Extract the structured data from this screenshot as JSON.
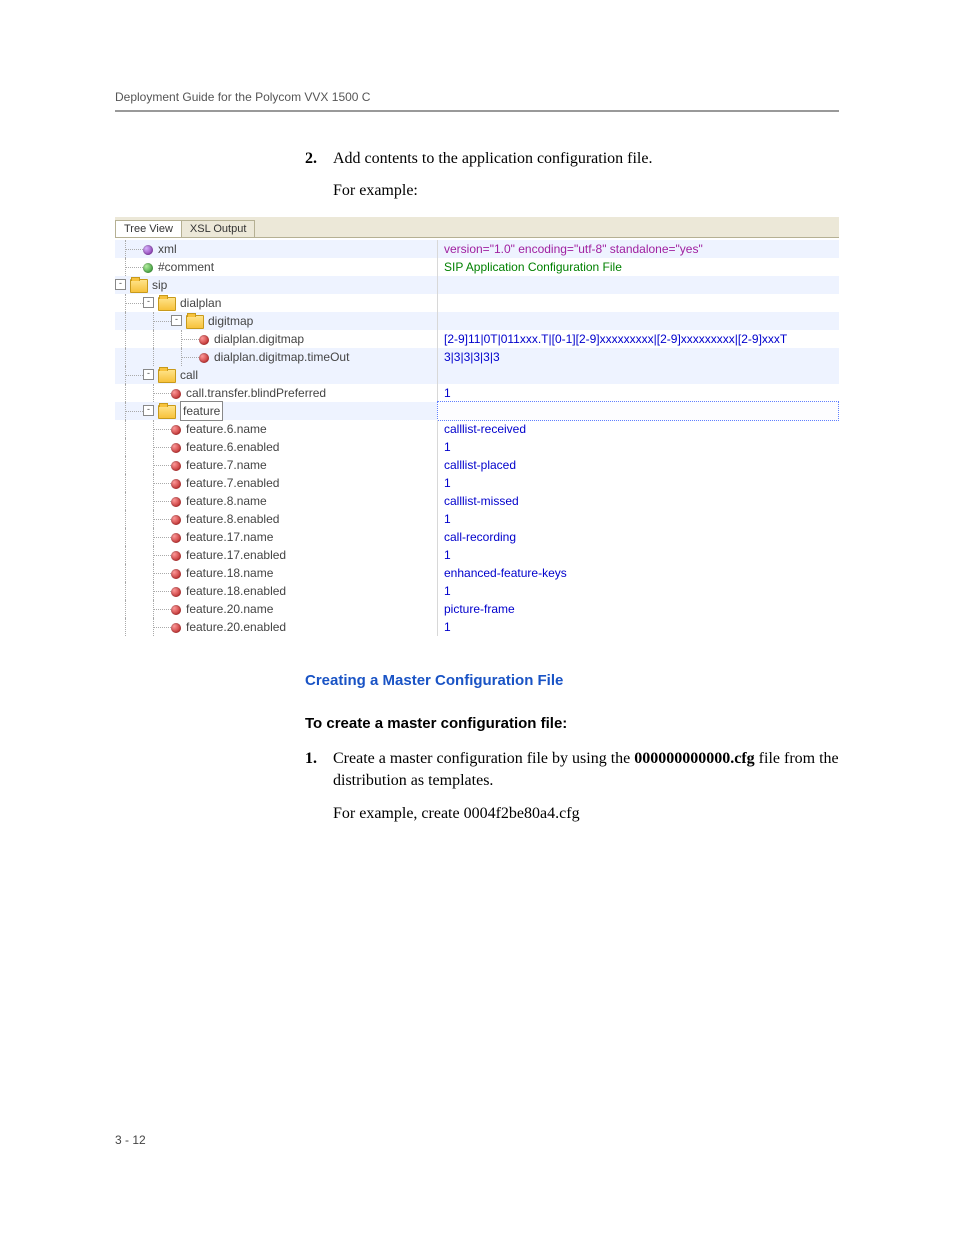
{
  "header": "Deployment Guide for the Polycom VVX 1500 C",
  "step2": {
    "num": "2.",
    "text": "Add contents to the application configuration file.",
    "sub": "For example:"
  },
  "tabs": {
    "active": "Tree View",
    "inactive": "XSL Output"
  },
  "tree": [
    {
      "indent": 1,
      "icon": "ball-purple",
      "label": "xml",
      "value": "version=\"1.0\" encoding=\"utf-8\" standalone=\"yes\"",
      "vclass": "purple",
      "hl": true
    },
    {
      "indent": 1,
      "icon": "ball-green",
      "label": "#comment",
      "value": "SIP Application Configuration File",
      "vclass": "green"
    },
    {
      "indent": 0,
      "expander": "-",
      "icon": "folder",
      "label": "sip",
      "value": "",
      "hl": true
    },
    {
      "indent": 1,
      "expander": "-",
      "icon": "folder",
      "label": "dialplan",
      "value": ""
    },
    {
      "indent": 2,
      "expander": "-",
      "icon": "folder",
      "label": "digitmap",
      "value": "",
      "hl": true
    },
    {
      "indent": 3,
      "icon": "ball-red",
      "label": "dialplan.digitmap",
      "value": "[2-9]11|0T|011xxx.T|[0-1][2-9]xxxxxxxxx|[2-9]xxxxxxxxx|[2-9]xxxT",
      "vclass": "blue"
    },
    {
      "indent": 3,
      "icon": "ball-red",
      "label": "dialplan.digitmap.timeOut",
      "value": "3|3|3|3|3|3",
      "vclass": "blue",
      "hl": true
    },
    {
      "indent": 1,
      "expander": "-",
      "icon": "folder",
      "label": "call",
      "value": "",
      "hl": true
    },
    {
      "indent": 2,
      "icon": "ball-red",
      "label": "call.transfer.blindPreferred",
      "value": "1",
      "vclass": "blue"
    },
    {
      "indent": 1,
      "expander": "-",
      "icon": "folder",
      "label": "feature",
      "value": "",
      "hl": true,
      "boxed": true,
      "selectedValue": true
    },
    {
      "indent": 2,
      "icon": "ball-red",
      "label": "feature.6.name",
      "value": "calllist-received",
      "vclass": "blue"
    },
    {
      "indent": 2,
      "icon": "ball-red",
      "label": "feature.6.enabled",
      "value": "1",
      "vclass": "blue"
    },
    {
      "indent": 2,
      "icon": "ball-red",
      "label": "feature.7.name",
      "value": "calllist-placed",
      "vclass": "blue"
    },
    {
      "indent": 2,
      "icon": "ball-red",
      "label": "feature.7.enabled",
      "value": "1",
      "vclass": "blue"
    },
    {
      "indent": 2,
      "icon": "ball-red",
      "label": "feature.8.name",
      "value": "calllist-missed",
      "vclass": "blue"
    },
    {
      "indent": 2,
      "icon": "ball-red",
      "label": "feature.8.enabled",
      "value": "1",
      "vclass": "blue"
    },
    {
      "indent": 2,
      "icon": "ball-red",
      "label": "feature.17.name",
      "value": "call-recording",
      "vclass": "blue"
    },
    {
      "indent": 2,
      "icon": "ball-red",
      "label": "feature.17.enabled",
      "value": "1",
      "vclass": "blue"
    },
    {
      "indent": 2,
      "icon": "ball-red",
      "label": "feature.18.name",
      "value": "enhanced-feature-keys",
      "vclass": "blue"
    },
    {
      "indent": 2,
      "icon": "ball-red",
      "label": "feature.18.enabled",
      "value": "1",
      "vclass": "blue"
    },
    {
      "indent": 2,
      "icon": "ball-red",
      "label": "feature.20.name",
      "value": "picture-frame",
      "vclass": "blue"
    },
    {
      "indent": 2,
      "icon": "ball-red",
      "label": "feature.20.enabled",
      "value": "1",
      "vclass": "blue"
    }
  ],
  "section": {
    "blue_heading": "Creating a Master Configuration File",
    "black_heading": "To create a master configuration file:",
    "step1_num": "1.",
    "step1_a": "Create a master configuration file by using the ",
    "step1_bold": "000000000000.cfg",
    "step1_b": " file from the distribution as templates.",
    "step1_sub": "For example, create 0004f2be80a4.cfg"
  },
  "footer": "3 - 12"
}
